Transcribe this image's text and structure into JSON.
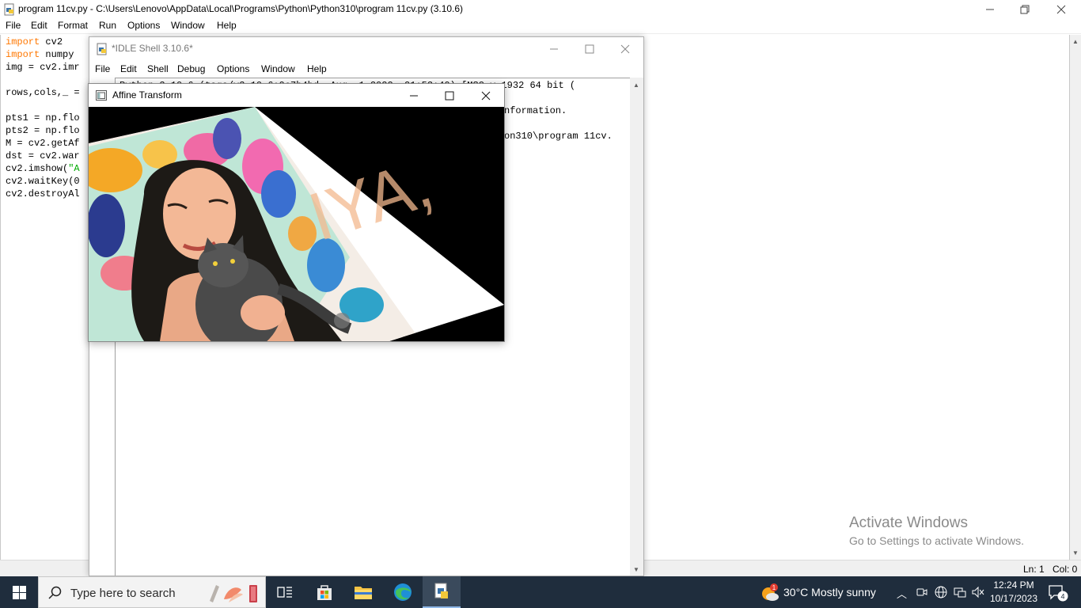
{
  "editor": {
    "title": "program 11cv.py - C:\\Users\\Lenovo\\AppData\\Local\\Programs\\Python\\Python310\\program 11cv.py (3.10.6)",
    "menu": [
      "File",
      "Edit",
      "Format",
      "Run",
      "Options",
      "Window",
      "Help"
    ],
    "code": {
      "l1_kw": "import",
      "l1_rest": " cv2",
      "l2_kw": "import",
      "l2_rest": " numpy",
      "l3": "img = cv2.imr",
      "l4": "",
      "l5": "rows,cols,_ =",
      "l6": "",
      "l7": "pts1 = np.flo",
      "l8": "pts2 = np.flo",
      "l9": "M = cv2.getAf",
      "l10": "dst = cv2.war",
      "l11_a": "cv2.imshow(",
      "l11_str": "\"A",
      "l12": "cv2.waitKey(0",
      "l13": "cv2.destroyAl"
    },
    "status": {
      "line": "Ln: 1",
      "col": "Col: 0"
    }
  },
  "shell": {
    "title": "*IDLE Shell 3.10.6*",
    "menu": [
      "File",
      "Edit",
      "Shell",
      "Debug",
      "Options",
      "Window",
      "Help"
    ],
    "lines": {
      "l1": "Python 3.10.6 (tags/v3.10.6:9c7b4bd, Aug  1 2022, 21:53:49) [MSC v.1932 64 bit (",
      "l2": "nformation.",
      "l3": "on310\\program 11cv."
    }
  },
  "affine": {
    "title": "Affine Transform",
    "watermark_text": "IYA,"
  },
  "watermark": {
    "line1": "Activate Windows",
    "line2": "Go to Settings to activate Windows."
  },
  "taskbar": {
    "search_placeholder": "Type here to search",
    "weather": "30°C  Mostly sunny",
    "weather_badge": "1",
    "time": "12:24 PM",
    "date": "10/17/2023",
    "notification_count": "4"
  }
}
